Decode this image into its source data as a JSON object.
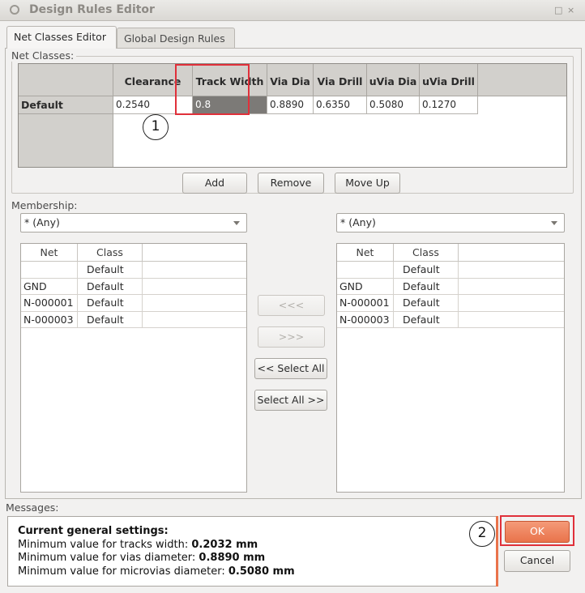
{
  "window": {
    "title": "Design Rules Editor",
    "controls": "□ ×"
  },
  "tabs": [
    {
      "label": "Net Classes Editor",
      "active": true
    },
    {
      "label": "Global Design Rules",
      "active": false
    }
  ],
  "net_classes": {
    "label": "Net Classes:",
    "columns": [
      "Clearance",
      "Track Width",
      "Via Dia",
      "Via Drill",
      "uVia Dia",
      "uVia Drill"
    ],
    "rows": [
      {
        "name": "Default",
        "values": [
          "0.2540",
          "0.8",
          "0.8890",
          "0.6350",
          "0.5080",
          "0.1270"
        ]
      }
    ],
    "buttons": {
      "add": "Add",
      "remove": "Remove",
      "move_up": "Move Up"
    }
  },
  "membership": {
    "label": "Membership:",
    "left": {
      "filter": "* (Any)",
      "headers": [
        "Net",
        "Class"
      ],
      "rows": [
        [
          "",
          "Default"
        ],
        [
          "GND",
          "Default"
        ],
        [
          "N-000001",
          "Default"
        ],
        [
          "N-000003",
          "Default"
        ]
      ]
    },
    "right": {
      "filter": "* (Any)",
      "headers": [
        "Net",
        "Class"
      ],
      "rows": [
        [
          "",
          "Default"
        ],
        [
          "GND",
          "Default"
        ],
        [
          "N-000001",
          "Default"
        ],
        [
          "N-000003",
          "Default"
        ]
      ]
    },
    "move_buttons": {
      "move_left": "<<<",
      "move_right": ">>>",
      "select_all_left": "<< Select All",
      "select_all_right": "Select All >>"
    }
  },
  "messages": {
    "label": "Messages:",
    "title": "Current general settings:",
    "lines": [
      {
        "text": "Minimum value for tracks width: ",
        "value": "0.2032 mm"
      },
      {
        "text": "Minimum value for vias diameter: ",
        "value": "0.8890 mm"
      },
      {
        "text": "Minimum value for microvias diameter: ",
        "value": "0.5080 mm"
      }
    ]
  },
  "dialog_buttons": {
    "ok": "OK",
    "cancel": "Cancel"
  },
  "annotations": {
    "one": "1",
    "two": "2"
  },
  "colors": {
    "highlight": "#e0303a",
    "ok_button": "#e9734b",
    "selected_cell": "#7c7a77"
  }
}
